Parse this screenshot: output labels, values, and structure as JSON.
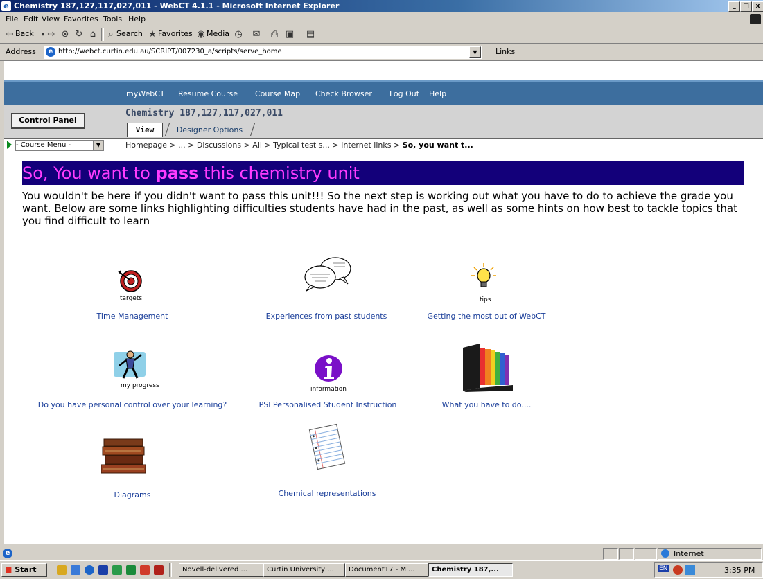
{
  "window": {
    "title": "Chemistry 187,127,117,027,011 - WebCT 4.1.1 - Microsoft Internet Explorer",
    "buttons": [
      "_",
      "□",
      "x"
    ]
  },
  "menu": [
    "File",
    "Edit",
    "View",
    "Favorites",
    "Tools",
    "Help"
  ],
  "toolbar": {
    "back": "Back",
    "search": "Search",
    "favorites": "Favorites",
    "media": "Media"
  },
  "address": {
    "label": "Address",
    "url": "http://webct.curtin.edu.au/SCRIPT/007230_a/scripts/serve_home",
    "links": "Links"
  },
  "webct_nav": [
    "myWebCT",
    "Resume Course",
    "Course Map",
    "Check Browser",
    "Log Out",
    "Help"
  ],
  "header": {
    "control_panel": "Control Panel",
    "course_title": "Chemistry 187,127,117,027,011",
    "tab_view": "View",
    "tab_designer": "Designer Options"
  },
  "course_menu": "- Course Menu -",
  "breadcrumb": {
    "path": "Homepage > ... > Discussions > All > Typical test s... > Internet links > ",
    "current": "So, you want t..."
  },
  "content": {
    "title_pre": "So, You want to ",
    "title_bold": "pass",
    "title_post": " this chemistry unit",
    "intro": "You wouldn't be here if you didn't want to pass this unit!!! So the next step is working out what you have to do to achieve the grade you want. Below are some links highlighting difficulties students have had in the past, as well as some hints on how best to tackle topics that you find difficult to learn",
    "tiles": [
      {
        "caption": "Time Management",
        "icon_label": "targets",
        "icon": "target-icon"
      },
      {
        "caption": "Experiences from past students",
        "icon_label": "",
        "icon": "speech-bubbles-icon"
      },
      {
        "caption": "Getting the most out of WebCT",
        "icon_label": "tips",
        "icon": "lightbulb-icon"
      },
      {
        "caption": "Do you have personal control over your learning?",
        "icon_label": "my progress",
        "icon": "runner-icon"
      },
      {
        "caption": "PSI Personalised Student Instruction",
        "icon_label": "information",
        "icon": "information-icon"
      },
      {
        "caption": "What you have to do....",
        "icon_label": "",
        "icon": "file-folders-icon"
      },
      {
        "caption": "Diagrams",
        "icon_label": "",
        "icon": "books-icon"
      },
      {
        "caption": "Chemical representations",
        "icon_label": "",
        "icon": "notepad-icon"
      }
    ]
  },
  "status": {
    "zone": "Internet"
  },
  "taskbar": {
    "start": "Start",
    "tasks": [
      "Novell-delivered ...",
      "Curtin University ...",
      "Document17 - Mi...",
      "Chemistry 187,..."
    ],
    "lang": "EN",
    "time": "3:35 PM"
  }
}
